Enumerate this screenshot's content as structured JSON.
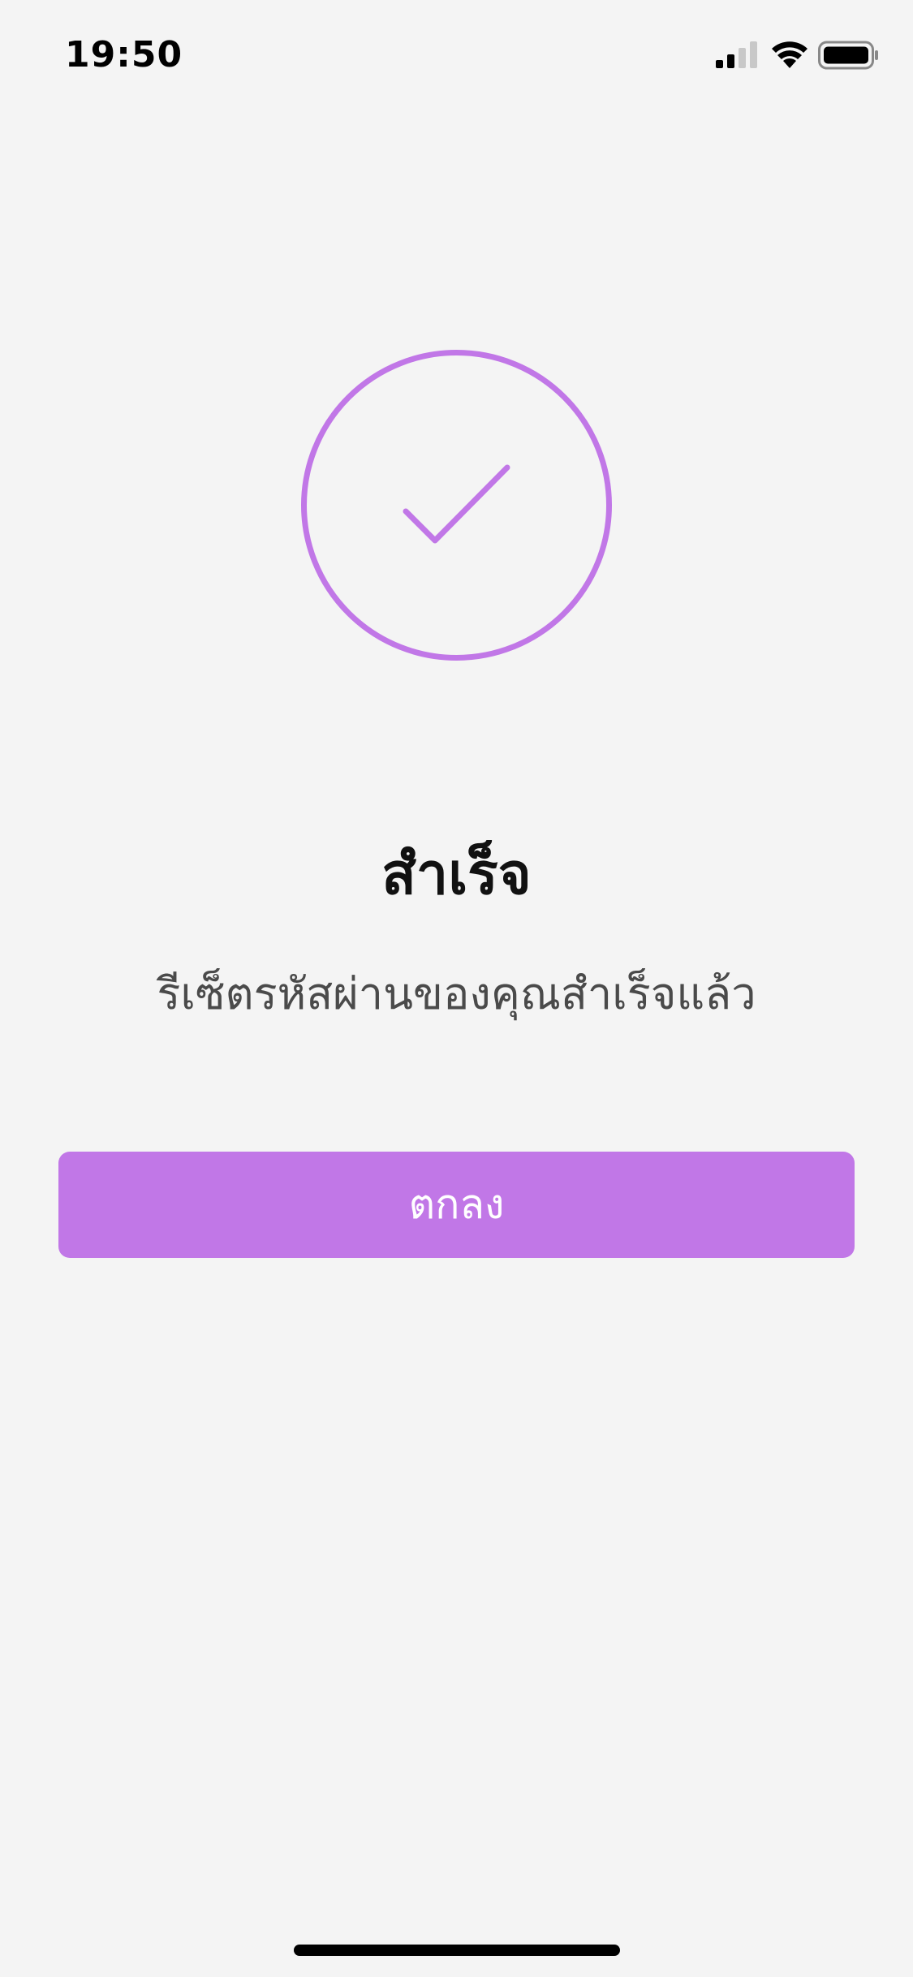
{
  "status_bar": {
    "time": "19:50",
    "icons": [
      "signal-icon",
      "wifi-icon",
      "battery-icon"
    ]
  },
  "colors": {
    "accent": "#c177e7",
    "background": "#f4f4f4",
    "title": "#111111",
    "message": "#4a4a4a",
    "button_text": "#ffffff"
  },
  "success": {
    "icon": "check-circle-icon",
    "title": "สำเร็จ",
    "message": "รีเซ็ตรหัสผ่านของคุณสำเร็จแล้ว"
  },
  "actions": {
    "ok_label": "ตกลง"
  }
}
